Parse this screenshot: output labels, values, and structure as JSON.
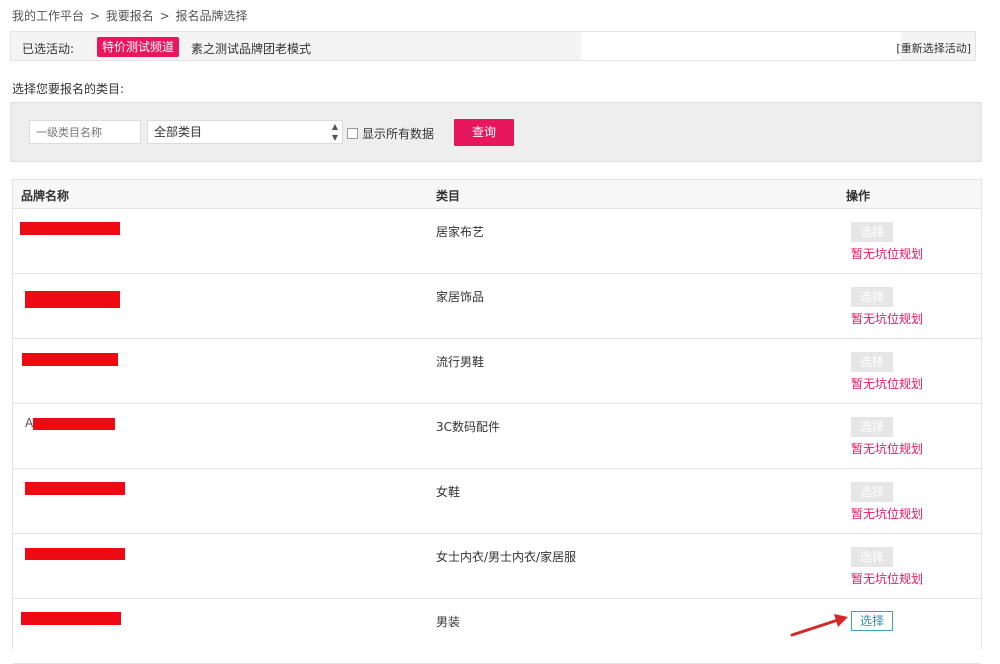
{
  "breadcrumb": {
    "items": [
      "我的工作平台",
      "我要报名",
      "报名品牌选择"
    ],
    "separator": ">"
  },
  "activity": {
    "label": "已选活动:",
    "tag": "特价测试频道",
    "name": "素之测试品牌团老模式",
    "reselect": "[重新选择活动]"
  },
  "prompt": "选择您要报名的类目:",
  "filter": {
    "category_placeholder": "一级类目名称",
    "category_select": "全部类目",
    "show_all_label": "显示所有数据",
    "query_button": "查询"
  },
  "table": {
    "headers": {
      "brand": "品牌名称",
      "category": "类目",
      "action": "操作"
    },
    "rows": [
      {
        "brand_visible": "",
        "category": "居家布艺",
        "action": "选择",
        "status": "暂无坑位规划",
        "enabled": false
      },
      {
        "brand_visible": "",
        "category": "家居饰品",
        "action": "选择",
        "status": "暂无坑位规划",
        "enabled": false
      },
      {
        "brand_visible": "",
        "category": "流行男鞋",
        "action": "选择",
        "status": "暂无坑位规划",
        "enabled": false
      },
      {
        "brand_visible": "A",
        "category": "3C数码配件",
        "action": "选择",
        "status": "暂无坑位规划",
        "enabled": false
      },
      {
        "brand_visible": "",
        "category": "女鞋",
        "action": "选择",
        "status": "暂无坑位规划",
        "enabled": false
      },
      {
        "brand_visible": "",
        "category": "女士内衣/男士内衣/家居服",
        "action": "选择",
        "status": "暂无坑位规划",
        "enabled": false
      },
      {
        "brand_visible": "",
        "category": "男装",
        "action": "选择",
        "status": "",
        "enabled": true
      }
    ]
  },
  "colors": {
    "accent": "#e8175d",
    "redaction": "#ee0a12",
    "link_blue": "#2b8fb6",
    "arrow": "#d62828"
  },
  "icons": {
    "select_arrows": "up-down-arrows-icon",
    "annotation_arrow": "red-arrow-icon"
  }
}
